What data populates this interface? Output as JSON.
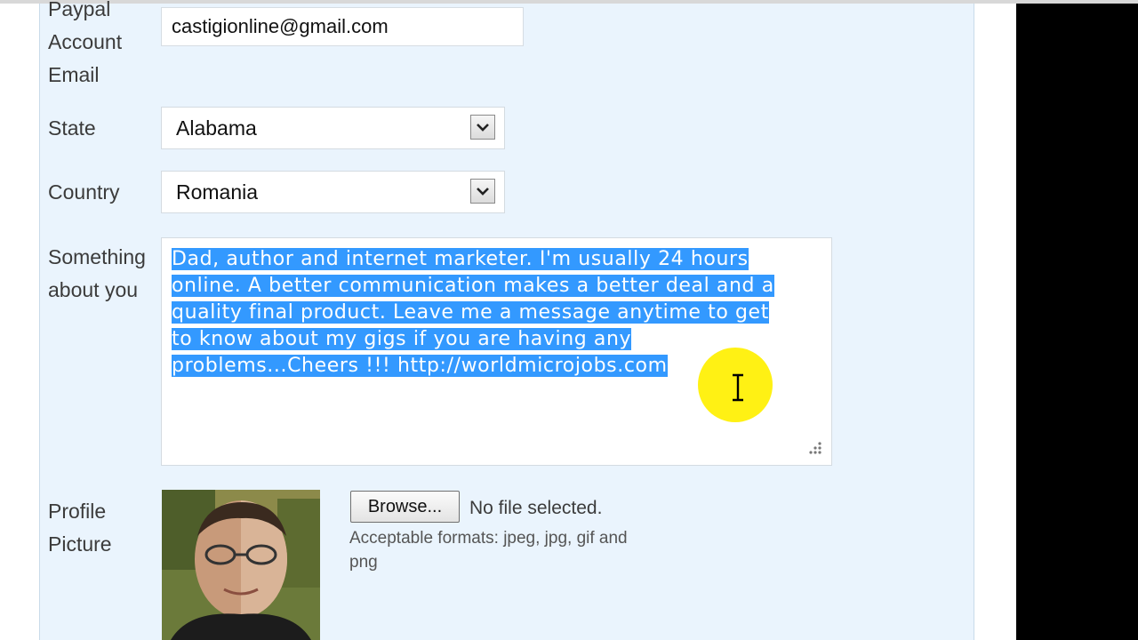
{
  "form": {
    "paypal": {
      "label_lines": [
        "Paypal",
        "Account",
        "Email"
      ],
      "value": "castigionline@gmail.com"
    },
    "state": {
      "label": "State",
      "value": "Alabama"
    },
    "country": {
      "label": "Country",
      "value": "Romania"
    },
    "about": {
      "label_lines": [
        "Something",
        "about you"
      ],
      "lines": [
        "Dad, author and internet marketer. I'm usually 24 hours",
        "online. A better communication makes a better deal and a",
        "quality final product. Leave me a message anytime to get",
        "to know about my gigs if you are having any",
        "problems...Cheers !!! http://worldmicrojobs.com"
      ]
    },
    "profile": {
      "label_lines": [
        "Profile",
        "Picture"
      ],
      "browse_label": "Browse...",
      "file_status": "No file selected.",
      "formats_hint": "Acceptable formats: jpeg, jpg, gif and png"
    }
  },
  "colors": {
    "panel_bg": "#eaf4fd",
    "selection": "#3399ff",
    "cursor_highlight": "#fff000"
  },
  "icons": {
    "dropdown": "chevron-down-icon",
    "resize": "resize-grip-icon",
    "cursor": "text-cursor-icon"
  }
}
